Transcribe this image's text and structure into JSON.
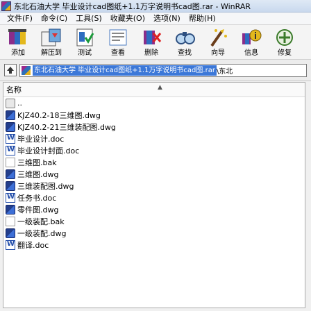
{
  "window": {
    "title": "东北石油大学 毕业设计cad图纸+1.1万字说明书cad图.rar - WinRAR"
  },
  "menu": [
    "文件(F)",
    "命令(C)",
    "工具(S)",
    "收藏夹(O)",
    "选项(N)",
    "帮助(H)"
  ],
  "toolbar": [
    {
      "label": "添加",
      "icon": "add-icon"
    },
    {
      "label": "解压到",
      "icon": "extract-to-icon"
    },
    {
      "label": "测试",
      "icon": "test-icon"
    },
    {
      "label": "查看",
      "icon": "view-icon"
    },
    {
      "label": "删除",
      "icon": "delete-icon"
    },
    {
      "label": "查找",
      "icon": "find-icon"
    },
    {
      "label": "向导",
      "icon": "wizard-icon"
    },
    {
      "label": "信息",
      "icon": "info-icon"
    },
    {
      "label": "修复",
      "icon": "repair-icon"
    }
  ],
  "address": {
    "path": "东北石油大学 毕业设计cad图纸+1.1万字说明书cad图.rar",
    "suffix": "\\东北"
  },
  "list": {
    "column_name": "名称",
    "files": [
      {
        "name": "..",
        "type": "folder"
      },
      {
        "name": "KJZ40.2-18三维图.dwg",
        "type": "dwg"
      },
      {
        "name": "KJZ40.2-21三维装配图.dwg",
        "type": "dwg"
      },
      {
        "name": "毕业设计.doc",
        "type": "doc"
      },
      {
        "name": "毕业设计封面.doc",
        "type": "doc"
      },
      {
        "name": "三维图.bak",
        "type": "bak"
      },
      {
        "name": "三维图.dwg",
        "type": "dwg"
      },
      {
        "name": "三维装配图.dwg",
        "type": "dwg"
      },
      {
        "name": "任务书.doc",
        "type": "doc"
      },
      {
        "name": "零件图.dwg",
        "type": "dwg"
      },
      {
        "name": "一级装配.bak",
        "type": "bak"
      },
      {
        "name": "一级装配.dwg",
        "type": "dwg"
      },
      {
        "name": "翻译.doc",
        "type": "doc"
      }
    ]
  }
}
